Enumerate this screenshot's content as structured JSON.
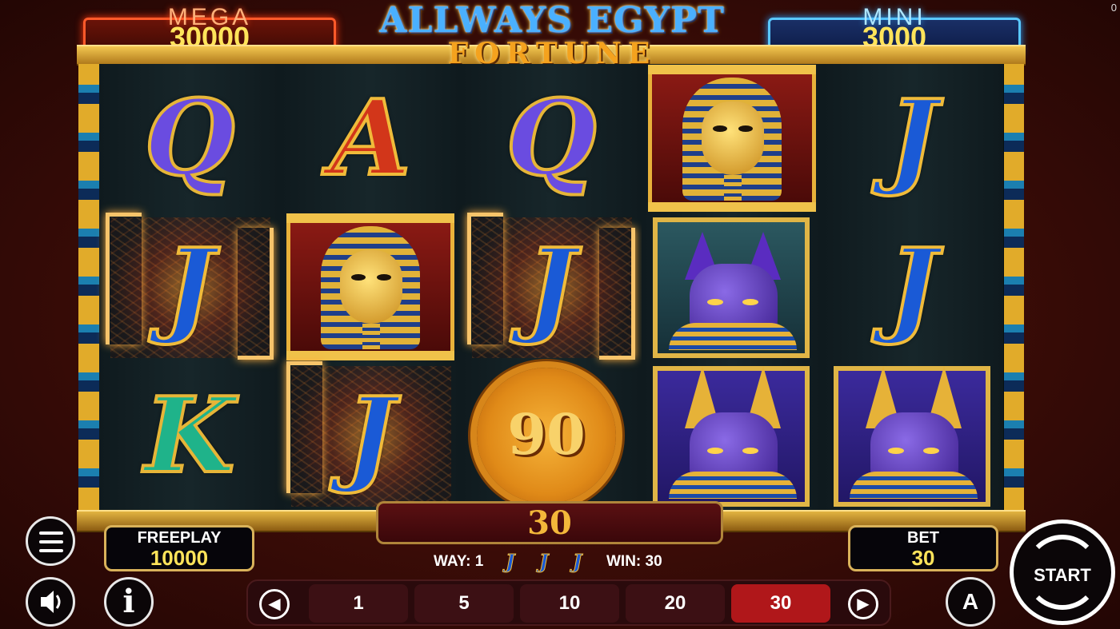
{
  "corner_counter": "0",
  "logo": {
    "line1": "ALLWAYS EGYPT",
    "line2": "FORTUNE"
  },
  "jackpots": {
    "mega": {
      "label": "MEGA",
      "value": "30000"
    },
    "mini": {
      "label": "MINI",
      "value": "3000"
    }
  },
  "reels": {
    "symbols": [
      [
        "Q",
        "J",
        "K"
      ],
      [
        "A",
        "pharaoh",
        "J"
      ],
      [
        "Q",
        "J",
        "coin-90"
      ],
      [
        "pharaoh",
        "cat",
        "anubis"
      ],
      [
        "J",
        "J",
        "anubis"
      ]
    ],
    "coin_value": "90",
    "highlighted_cells": [
      "reel1-row2",
      "reel2-row3",
      "reel3-row2"
    ]
  },
  "freeplay": {
    "label": "FREEPLAY",
    "value": "10000"
  },
  "bet": {
    "label": "BET",
    "value": "30"
  },
  "win_display": "30",
  "way_info": {
    "way": "WAY: 1",
    "symbol": "J",
    "symbol_count": 3,
    "win": "WIN: 30"
  },
  "bet_options": [
    "1",
    "5",
    "10",
    "20",
    "30"
  ],
  "selected_bet": "30",
  "buttons": {
    "start": "START",
    "auto": "A",
    "info": "i"
  },
  "icons": [
    "menu-icon",
    "speaker-icon",
    "info-icon",
    "auto-icon",
    "start-icon",
    "arrow-left-icon",
    "arrow-right-icon"
  ],
  "colors": {
    "gold": "#e8b13a",
    "win_gold": "#ffe45a",
    "selected_bet": "#b0171a",
    "mega_glow": "#ff5a2a",
    "mini_glow": "#5ac8ff"
  }
}
